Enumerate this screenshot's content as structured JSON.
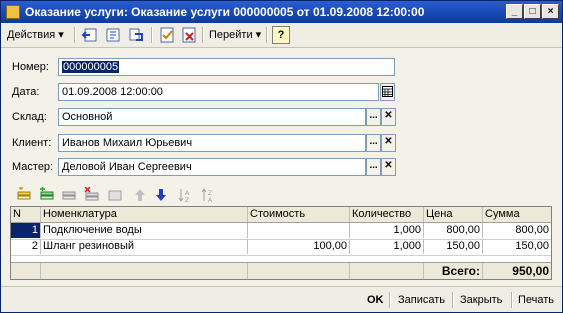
{
  "window": {
    "title": "Оказание услуги: Оказание услуги 000000005 от 01.09.2008 12:00:00",
    "controls": {
      "minimize": "_",
      "maximize": "□",
      "close": "×"
    }
  },
  "toolbar": {
    "actions_label": "Действия",
    "goto_label": "Перейти",
    "help_label": "?"
  },
  "form": {
    "number": {
      "label": "Номер:",
      "value": "000000005"
    },
    "date": {
      "label": "Дата:",
      "value": "01.09.2008 12:00:00"
    },
    "warehouse": {
      "label": "Склад:",
      "value": "Основной"
    },
    "client": {
      "label": "Клиент:",
      "value": "Иванов Михаил Юрьевич"
    },
    "master": {
      "label": "Мастер:",
      "value": "Деловой Иван Сергеевич"
    }
  },
  "table": {
    "headers": [
      "N",
      "Номенклатура",
      "Стоимость",
      "Количество",
      "Цена",
      "Сумма"
    ],
    "rows": [
      {
        "n": "1",
        "item": "Подключение воды",
        "cost": "",
        "qty": "1,000",
        "price": "800,00",
        "sum": "800,00"
      },
      {
        "n": "2",
        "item": "Шланг резиновый",
        "cost": "100,00",
        "qty": "1,000",
        "price": "150,00",
        "sum": "150,00"
      }
    ],
    "total_label": "Всего:",
    "total_value": "950,00"
  },
  "buttons": {
    "ok": "OK",
    "save": "Записать",
    "close": "Закрыть",
    "print": "Печать"
  },
  "icons": [
    "app-icon",
    "actions-dropdown",
    "back-icon",
    "structure-icon",
    "refresh-icon",
    "post-icon",
    "unpost-icon",
    "help-icon",
    "add-row-icon",
    "copy-row-icon",
    "edit-row-icon",
    "delete-row-icon",
    "end-edit-icon",
    "move-up-icon",
    "move-down-icon",
    "sort-asc-icon",
    "sort-desc-icon",
    "calendar-icon",
    "select-icon",
    "clear-icon"
  ]
}
